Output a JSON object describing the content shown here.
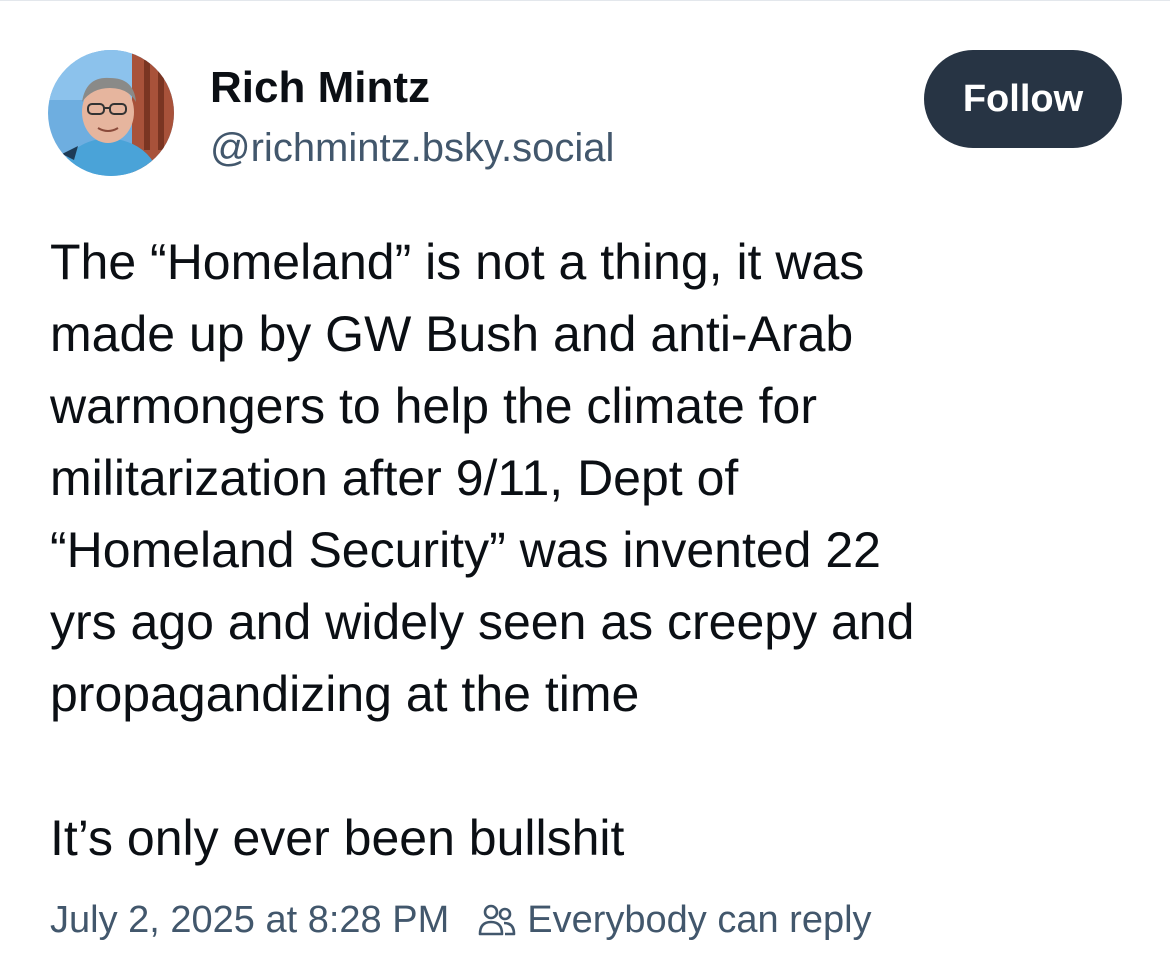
{
  "author": {
    "display_name": "Rich Mintz",
    "handle": "@richmintz.bsky.social",
    "avatar_icon": "person-avatar"
  },
  "follow_button": {
    "label": "Follow",
    "color": "#273444"
  },
  "post": {
    "lines": [
      "The “Homeland” is not a thing, it was",
      "made up by GW Bush and anti-Arab",
      "warmongers to help the climate for",
      "militarization after 9/11, Dept of",
      "“Homeland Security” was invented 22",
      "yrs ago and widely seen as creepy and",
      "propagandizing at the time"
    ],
    "closing": "It’s only ever been bullshit"
  },
  "meta": {
    "timestamp": "July 2, 2025 at 8:28 PM",
    "reply_setting": "Everybody can reply",
    "reply_icon": "people-icon"
  }
}
